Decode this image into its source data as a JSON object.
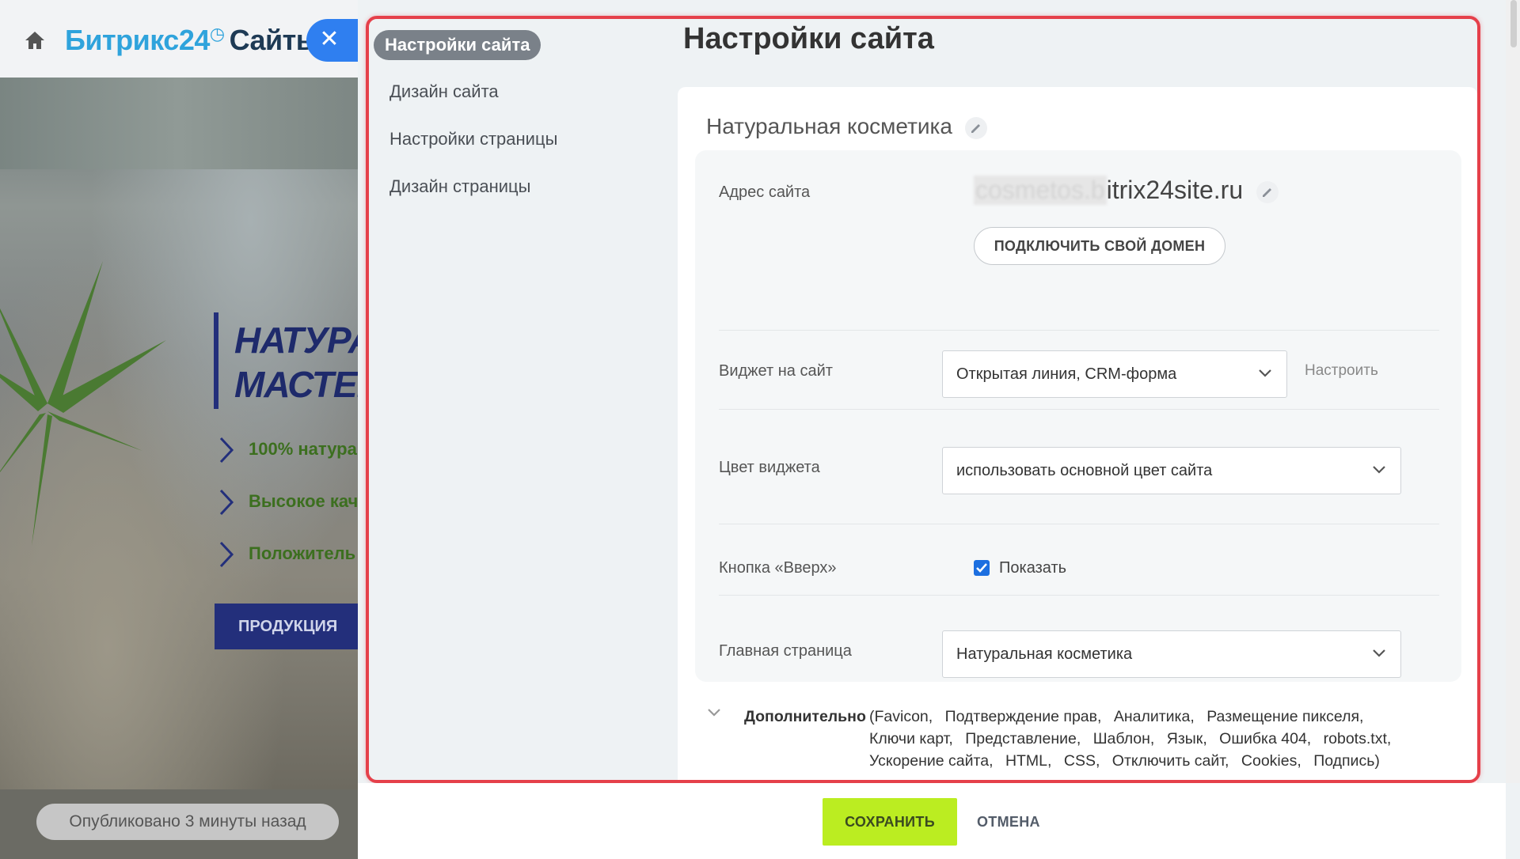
{
  "background": {
    "logo_main": "Битрикс24",
    "logo_clock": "◷",
    "logo_sites": "Сайты",
    "close_icon": "✕",
    "hero_line1": "НАТУРА",
    "hero_line2": "МАСТЕР",
    "bullets": [
      "100% натура",
      "Высокое кач",
      "Положитель"
    ],
    "button": "ПРОДУКЦИЯ",
    "published": "Опубликовано 3 минуты назад"
  },
  "sidebar": {
    "items": [
      {
        "label": "Настройки сайта",
        "active": true
      },
      {
        "label": "Дизайн сайта",
        "active": false
      },
      {
        "label": "Настройки страницы",
        "active": false
      },
      {
        "label": "Дизайн страницы",
        "active": false
      }
    ]
  },
  "page": {
    "title": "Настройки сайта",
    "site_name": "Натуральная косметика"
  },
  "form": {
    "address": {
      "label": "Адрес сайта",
      "blurred_part": "cosmetos.b",
      "domain_rest": "itrix24site.ru",
      "connect_button": "ПОДКЛЮЧИТЬ СВОЙ ДОМЕН"
    },
    "widget": {
      "label": "Виджет на сайт",
      "value": "Открытая линия, CRM-форма",
      "configure": "Настроить"
    },
    "widget_color": {
      "label": "Цвет виджета",
      "value": "использовать основной цвет сайта"
    },
    "up_button": {
      "label": "Кнопка «Вверх»",
      "checkbox_label": "Показать",
      "checked": true
    },
    "main_page": {
      "label": "Главная страница",
      "value": "Натуральная косметика"
    }
  },
  "additional": {
    "title": "Дополнительно",
    "items": [
      "(Favicon,",
      "Подтверждение прав,",
      "Аналитика,",
      "Размещение пикселя,",
      "Ключи карт,",
      "Представление,",
      "Шаблон,",
      "Язык,",
      "Ошибка 404,",
      "robots.txt,",
      "Ускорение сайта,",
      "HTML,",
      "CSS,",
      "Отключить сайт,",
      "Cookies,",
      "Подпись)"
    ]
  },
  "footer": {
    "save": "СОХРАНИТЬ",
    "cancel": "ОТМЕНА"
  },
  "colors": {
    "accent_blue": "#2f7ff0",
    "save_green": "#bbed21",
    "highlight_red": "#e5404a",
    "checkbox_blue": "#1c6fe0"
  }
}
